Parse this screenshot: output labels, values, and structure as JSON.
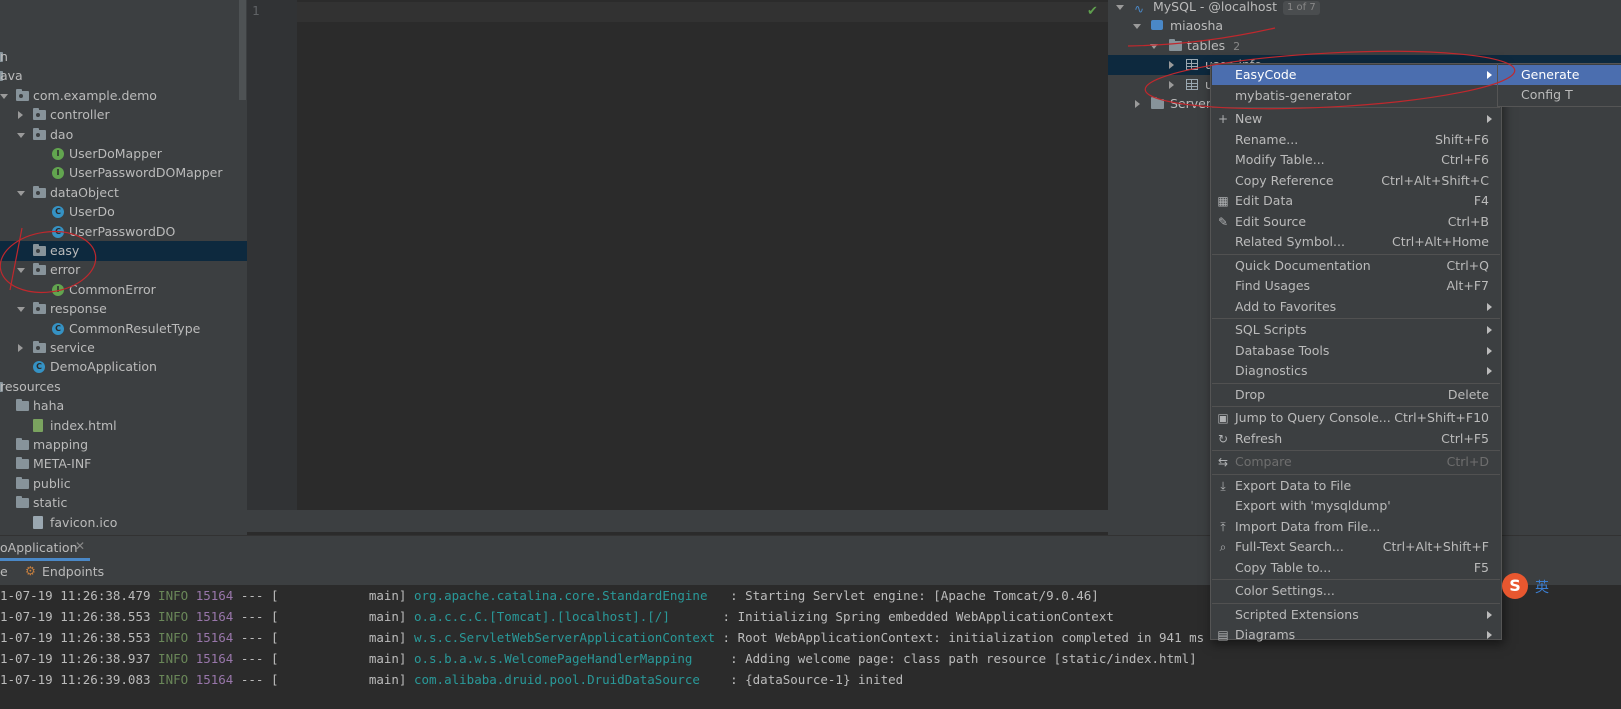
{
  "project_tree": {
    "items": [
      {
        "label": "n",
        "kind": "folder-partial"
      },
      {
        "label": "ava",
        "kind": "folder-partial"
      },
      {
        "label": "com.example.demo",
        "kind": "package"
      },
      {
        "label": "controller",
        "kind": "package"
      },
      {
        "label": "dao",
        "kind": "package"
      },
      {
        "label": "UserDoMapper",
        "kind": "interface"
      },
      {
        "label": "UserPasswordDOMapper",
        "kind": "interface"
      },
      {
        "label": "dataObject",
        "kind": "package"
      },
      {
        "label": "UserDo",
        "kind": "class"
      },
      {
        "label": "UserPasswordDO",
        "kind": "class"
      },
      {
        "label": "easy",
        "kind": "package"
      },
      {
        "label": "error",
        "kind": "package"
      },
      {
        "label": "CommonError",
        "kind": "interface"
      },
      {
        "label": "response",
        "kind": "package"
      },
      {
        "label": "CommonResuletType",
        "kind": "class"
      },
      {
        "label": "service",
        "kind": "package"
      },
      {
        "label": "DemoApplication",
        "kind": "spring-class"
      },
      {
        "label": "resources",
        "kind": "folder"
      },
      {
        "label": "haha",
        "kind": "folder"
      },
      {
        "label": "index.html",
        "kind": "html-file"
      },
      {
        "label": "mapping",
        "kind": "folder"
      },
      {
        "label": "META-INF",
        "kind": "folder"
      },
      {
        "label": "public",
        "kind": "folder"
      },
      {
        "label": "static",
        "kind": "folder"
      },
      {
        "label": "favicon.ico",
        "kind": "file"
      }
    ]
  },
  "editor": {
    "line_number": "1"
  },
  "database": {
    "root_label": "MySQL - @localhost",
    "root_badge": "1 of 7",
    "schema": "miaosha",
    "tables_folder": "tables",
    "tables_count": "2",
    "table_1": "user_info",
    "table_2": "u",
    "server_label": "Server"
  },
  "context_menu": {
    "items": [
      {
        "label": "EasyCode",
        "shortcut": "",
        "submenu": true,
        "active": true
      },
      {
        "label": "mybatis-generator",
        "shortcut": "",
        "submenu": false
      },
      {
        "sep": true
      },
      {
        "label": "New",
        "shortcut": "",
        "submenu": true,
        "icon": "plus-icon"
      },
      {
        "label": "Rename...",
        "shortcut": "Shift+F6"
      },
      {
        "label": "Modify Table...",
        "shortcut": "Ctrl+F6"
      },
      {
        "label": "Copy Reference",
        "shortcut": "Ctrl+Alt+Shift+C"
      },
      {
        "label": "Edit Data",
        "shortcut": "F4",
        "icon": "grid-icon"
      },
      {
        "label": "Edit Source",
        "shortcut": "Ctrl+B",
        "icon": "pencil-icon"
      },
      {
        "label": "Related Symbol...",
        "shortcut": "Ctrl+Alt+Home"
      },
      {
        "sep": true
      },
      {
        "label": "Quick Documentation",
        "shortcut": "Ctrl+Q"
      },
      {
        "label": "Find Usages",
        "shortcut": "Alt+F7"
      },
      {
        "label": "Add to Favorites",
        "shortcut": "",
        "submenu": true
      },
      {
        "sep": true
      },
      {
        "label": "SQL Scripts",
        "shortcut": "",
        "submenu": true
      },
      {
        "label": "Database Tools",
        "shortcut": "",
        "submenu": true
      },
      {
        "label": "Diagnostics",
        "shortcut": "",
        "submenu": true
      },
      {
        "sep": true
      },
      {
        "label": "Drop",
        "shortcut": "Delete"
      },
      {
        "sep": true
      },
      {
        "label": "Jump to Query Console...",
        "shortcut": "Ctrl+Shift+F10",
        "icon": "ql-icon"
      },
      {
        "label": "Refresh",
        "shortcut": "Ctrl+F5",
        "icon": "refresh-icon"
      },
      {
        "sep": true
      },
      {
        "label": "Compare",
        "shortcut": "Ctrl+D",
        "disabled": true,
        "icon": "compare-icon"
      },
      {
        "sep": true
      },
      {
        "label": "Export Data to File",
        "shortcut": "",
        "icon": "export-icon"
      },
      {
        "label": "Export with 'mysqldump'",
        "shortcut": ""
      },
      {
        "label": "Import Data from File...",
        "shortcut": "",
        "icon": "import-icon"
      },
      {
        "label": "Full-Text Search...",
        "shortcut": "Ctrl+Alt+Shift+F",
        "icon": "search-icon"
      },
      {
        "label": "Copy Table to...",
        "shortcut": "F5"
      },
      {
        "sep": true
      },
      {
        "label": "Color Settings...",
        "shortcut": ""
      },
      {
        "sep": true
      },
      {
        "label": "Scripted Extensions",
        "shortcut": "",
        "submenu": true
      },
      {
        "label": "Diagrams",
        "shortcut": "",
        "submenu": true,
        "icon": "diagram-icon"
      }
    ]
  },
  "submenu": {
    "item_1": "Generate",
    "item_2": "Config T"
  },
  "run_panel": {
    "tab_title": "oApplication",
    "left_tab": "e",
    "endpoints_tab": "Endpoints"
  },
  "console": {
    "lines": [
      {
        "ts": "1-07-19 11:26:38.479",
        "level": "INFO",
        "pid": "15164",
        "sep": "--- [",
        "thread": "           main]",
        "logger": "org.apache.catalina.core.StandardEngine  ",
        "msg": ": Starting Servlet engine: [Apache Tomcat/9.0.46]"
      },
      {
        "ts": "1-07-19 11:26:38.553",
        "level": "INFO",
        "pid": "15164",
        "sep": "--- [",
        "thread": "           main]",
        "logger": "o.a.c.c.C.[Tomcat].[localhost].[/]      ",
        "msg": ": Initializing Spring embedded WebApplicationContext"
      },
      {
        "ts": "1-07-19 11:26:38.553",
        "level": "INFO",
        "pid": "15164",
        "sep": "--- [",
        "thread": "           main]",
        "logger": "w.s.c.ServletWebServerApplicationContext",
        "msg": ": Root WebApplicationContext: initialization completed in 941 ms"
      },
      {
        "ts": "1-07-19 11:26:38.937",
        "level": "INFO",
        "pid": "15164",
        "sep": "--- [",
        "thread": "           main]",
        "logger": "o.s.b.a.w.s.WelcomePageHandlerMapping    ",
        "msg": ": Adding welcome page: class path resource [static/index.html]"
      },
      {
        "ts": "1-07-19 11:26:39.083",
        "level": "INFO",
        "pid": "15164",
        "sep": "--- [",
        "thread": "           main]",
        "logger": "com.alibaba.druid.pool.DruidDataSource   ",
        "msg": ": {dataSource-1} inited"
      }
    ]
  },
  "ime": {
    "label": "英"
  }
}
